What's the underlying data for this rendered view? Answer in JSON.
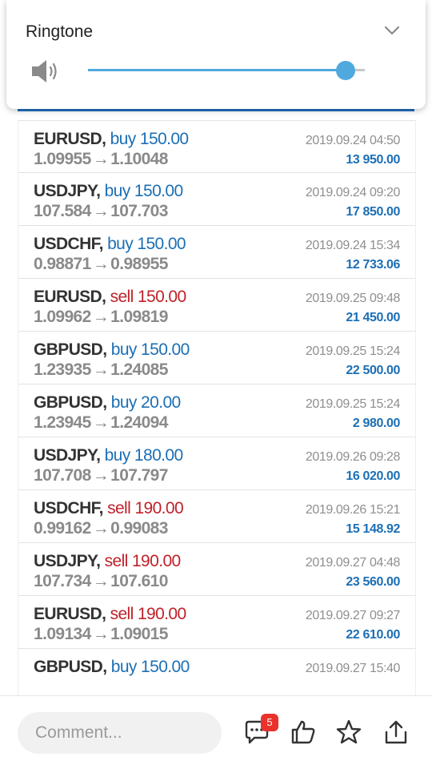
{
  "ringtone": {
    "title": "Ringtone",
    "volume_fraction": 0.93
  },
  "trades": [
    {
      "symbol": "EURUSD",
      "action": "buy",
      "volume": "150.00",
      "open_price": "1.09955",
      "close_price": "1.10048",
      "time": "2019.09.24 04:50",
      "profit": "13 950.00"
    },
    {
      "symbol": "USDJPY",
      "action": "buy",
      "volume": "150.00",
      "open_price": "107.584",
      "close_price": "107.703",
      "time": "2019.09.24 09:20",
      "profit": "17 850.00"
    },
    {
      "symbol": "USDCHF",
      "action": "buy",
      "volume": "150.00",
      "open_price": "0.98871",
      "close_price": "0.98955",
      "time": "2019.09.24 15:34",
      "profit": "12 733.06"
    },
    {
      "symbol": "EURUSD",
      "action": "sell",
      "volume": "150.00",
      "open_price": "1.09962",
      "close_price": "1.09819",
      "time": "2019.09.25 09:48",
      "profit": "21 450.00"
    },
    {
      "symbol": "GBPUSD",
      "action": "buy",
      "volume": "150.00",
      "open_price": "1.23935",
      "close_price": "1.24085",
      "time": "2019.09.25 15:24",
      "profit": "22 500.00"
    },
    {
      "symbol": "GBPUSD",
      "action": "buy",
      "volume": "20.00",
      "open_price": "1.23945",
      "close_price": "1.24094",
      "time": "2019.09.25 15:24",
      "profit": "2 980.00"
    },
    {
      "symbol": "USDJPY",
      "action": "buy",
      "volume": "180.00",
      "open_price": "107.708",
      "close_price": "107.797",
      "time": "2019.09.26 09:28",
      "profit": "16 020.00"
    },
    {
      "symbol": "USDCHF",
      "action": "sell",
      "volume": "190.00",
      "open_price": "0.99162",
      "close_price": "0.99083",
      "time": "2019.09.26 15:21",
      "profit": "15 148.92"
    },
    {
      "symbol": "USDJPY",
      "action": "sell",
      "volume": "190.00",
      "open_price": "107.734",
      "close_price": "107.610",
      "time": "2019.09.27 04:48",
      "profit": "23 560.00"
    },
    {
      "symbol": "EURUSD",
      "action": "sell",
      "volume": "190.00",
      "open_price": "1.09134",
      "close_price": "1.09015",
      "time": "2019.09.27 09:27",
      "profit": "22 610.00"
    },
    {
      "symbol": "GBPUSD",
      "action": "buy",
      "volume": "150.00",
      "open_price": "",
      "close_price": "",
      "time": "2019.09.27 15:40",
      "profit": ""
    }
  ],
  "arrow": "→",
  "bottom_bar": {
    "comment_placeholder": "Comment...",
    "comments_badge": "5",
    "icons": [
      "comments-icon",
      "thumbs-up-icon",
      "star-icon",
      "share-icon"
    ]
  },
  "colors": {
    "buy": "#1c6fb5",
    "sell": "#c0212a",
    "accent": "#4fa9dd",
    "header_strip": "#1f6fc0",
    "badge": "#e8322b"
  }
}
